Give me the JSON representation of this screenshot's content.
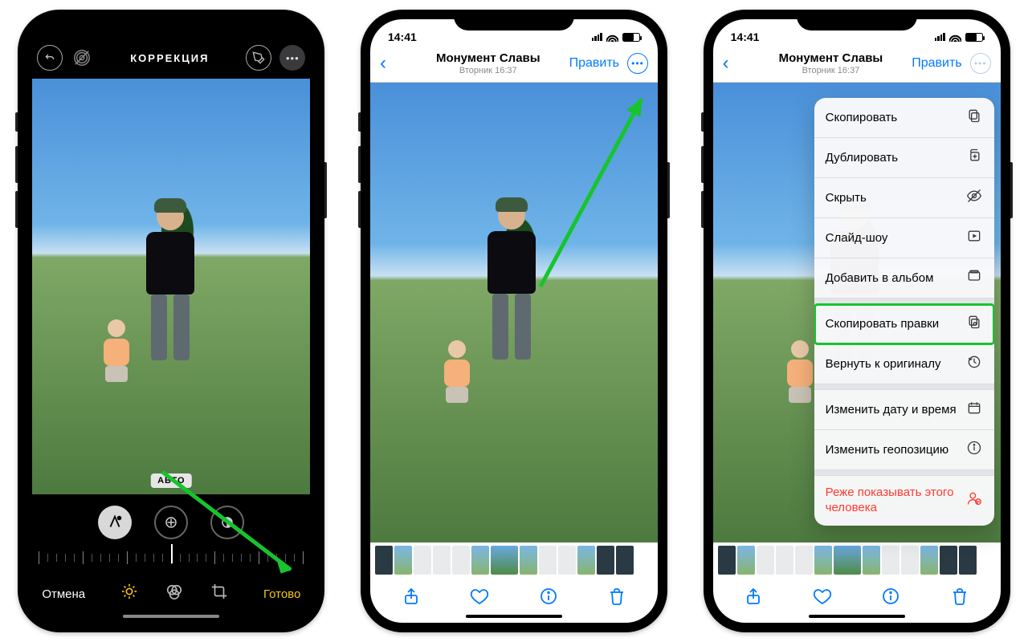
{
  "status": {
    "time": "14:41"
  },
  "phone1": {
    "title": "КОРРЕКЦИЯ",
    "auto_badge": "АВТО",
    "cancel": "Отмена",
    "done": "Готово"
  },
  "viewer_nav": {
    "title": "Монумент Славы",
    "subtitle": "Вторник  16:37",
    "edit": "Править"
  },
  "menu": {
    "items": [
      {
        "label": "Скопировать",
        "icon": "copy"
      },
      {
        "label": "Дублировать",
        "icon": "duplicate"
      },
      {
        "label": "Скрыть",
        "icon": "hide"
      },
      {
        "label": "Слайд-шоу",
        "icon": "slideshow"
      },
      {
        "label": "Добавить в альбом",
        "icon": "album"
      }
    ],
    "items2": [
      {
        "label": "Скопировать правки",
        "icon": "copy-edits",
        "highlight": true
      },
      {
        "label": "Вернуть к оригиналу",
        "icon": "revert"
      }
    ],
    "items3": [
      {
        "label": "Изменить дату и время",
        "icon": "date"
      },
      {
        "label": "Изменить геопозицию",
        "icon": "geo"
      }
    ],
    "items4": [
      {
        "label": "Реже показывать этого человека",
        "icon": "person",
        "red": true
      }
    ]
  }
}
